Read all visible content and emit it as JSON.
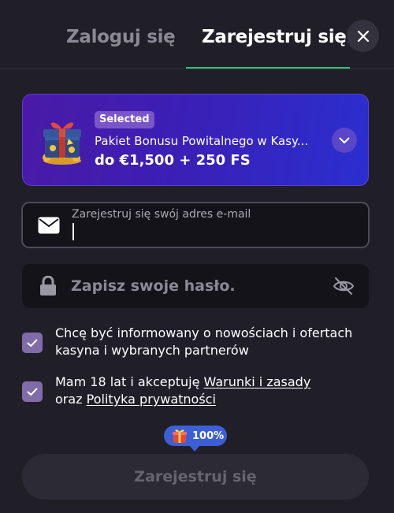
{
  "tabs": {
    "login_label": "Zaloguj się",
    "register_label": "Zarejestruj się",
    "active": "register"
  },
  "bonus": {
    "badge": "Selected",
    "name": "Pakiet Bonusu Powitalnego w Kasy...",
    "amount": "do €1,500 + 250 FS"
  },
  "email": {
    "label": "Zarejestruj się swój adres e-mail",
    "value": ""
  },
  "password": {
    "placeholder": "Zapisz swoje hasło.",
    "value": ""
  },
  "consents": {
    "marketing": {
      "checked": true,
      "text": "Chcę być informowany o nowościach i ofertach kasyna i wybranych partnerów"
    },
    "terms": {
      "checked": true,
      "text_before": "Mam 18 lat i akceptuję ",
      "terms_link": "Warunki i zasady",
      "text_middle": "oraz ",
      "privacy_link": "Polityka prywatności"
    }
  },
  "progress": {
    "label": "100%"
  },
  "submit": {
    "label": "Zarejestruj się"
  },
  "icons": {
    "close": "close-icon",
    "gift": "gift-icon",
    "chevron": "chevron-down-icon",
    "email": "envelope-icon",
    "password": "lock-icon",
    "toggle_visibility": "eye-off-icon",
    "checkbox": "checkmark-icon",
    "progress": "gift-icon"
  },
  "colors": {
    "background": "#201f28",
    "accent_green": "#2ec27e",
    "bonus_gradient_start": "#4a1aa6",
    "bonus_gradient_end": "#2a2fcf",
    "checkbox": "#7f6ca8",
    "progress_pill": "#3c5fd6"
  }
}
